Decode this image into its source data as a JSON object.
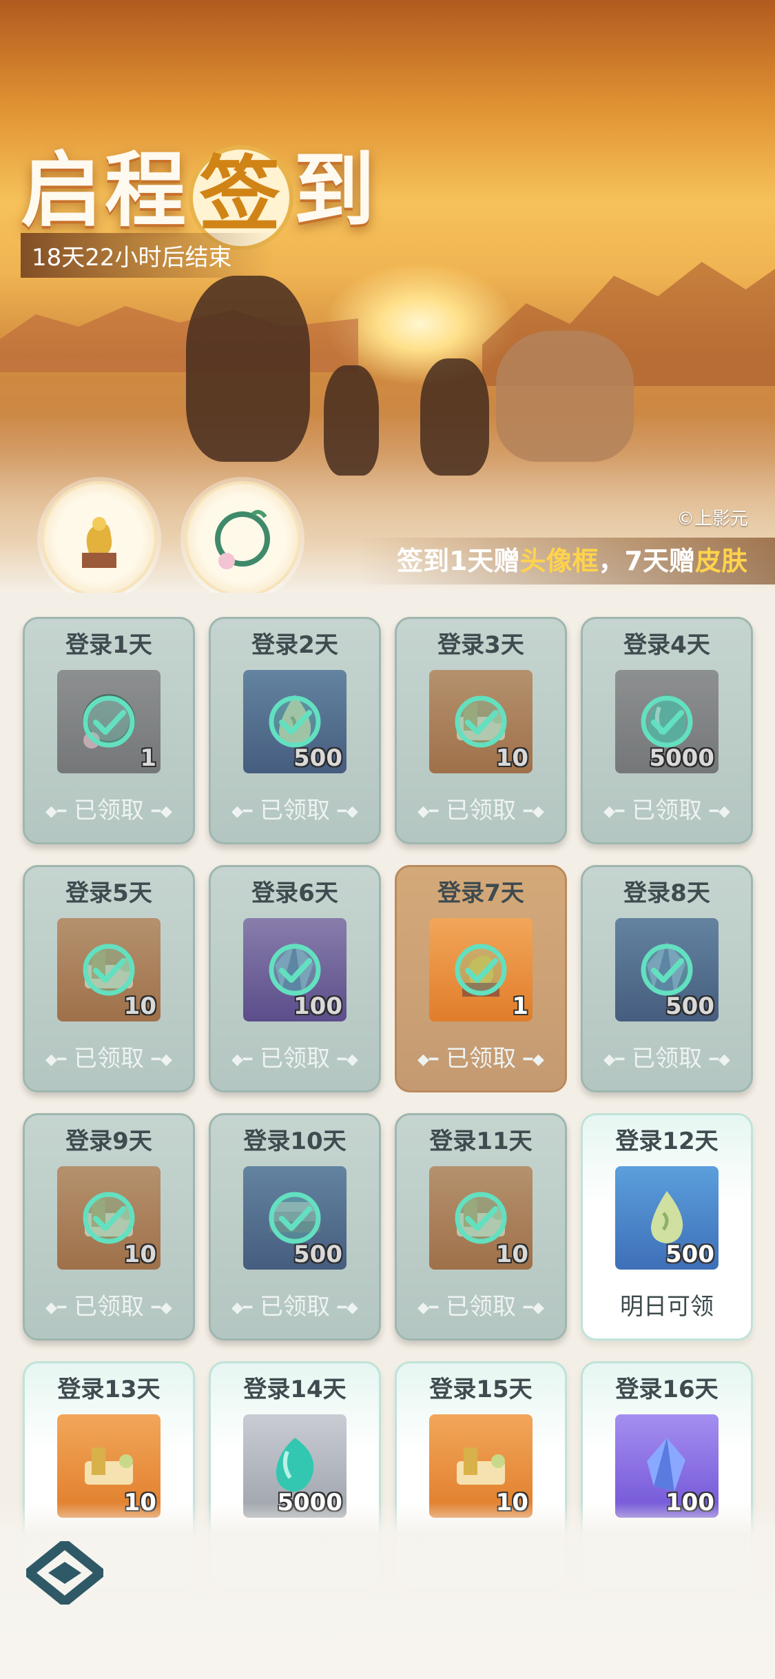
{
  "banner": {
    "title_part1": "启程",
    "title_badge": "签",
    "title_part2": "到",
    "countdown": "18天22小时后结束",
    "copyright": "©上影元",
    "promo": {
      "p1": "签到1天赠",
      "h1": "头像框",
      "p2": "，7天赠",
      "h2": "皮肤"
    },
    "rewards": [
      {
        "icon": "dragon-statue-icon"
      },
      {
        "icon": "avatar-frame-icon"
      }
    ]
  },
  "colors": {
    "claimed_card": "#b4c6c1",
    "special_card": "#c49a72",
    "open_card": "#ffffff",
    "check": "#63e0c0",
    "highlight": "#ffd34d"
  },
  "days": [
    {
      "label": "登录1天",
      "qty": "1",
      "item": "avatar-frame-icon",
      "bg": "grey",
      "status": "已领取",
      "state": "claimed"
    },
    {
      "label": "登录2天",
      "qty": "500",
      "item": "jade-drop-icon",
      "bg": "blue",
      "status": "已领取",
      "state": "claimed"
    },
    {
      "label": "登录3天",
      "qty": "10",
      "item": "scroll-icon",
      "bg": "orange",
      "status": "已领取",
      "state": "claimed"
    },
    {
      "label": "登录4天",
      "qty": "5000",
      "item": "teal-gem-icon",
      "bg": "grey",
      "status": "已领取",
      "state": "claimed"
    },
    {
      "label": "登录5天",
      "qty": "10",
      "item": "scroll-icon",
      "bg": "orange",
      "status": "已领取",
      "state": "claimed"
    },
    {
      "label": "登录6天",
      "qty": "100",
      "item": "crystal-icon",
      "bg": "purple",
      "status": "已领取",
      "state": "claimed"
    },
    {
      "label": "登录7天",
      "qty": "1",
      "item": "dragon-statue-icon",
      "bg": "orange",
      "status": "已领取",
      "state": "special"
    },
    {
      "label": "登录8天",
      "qty": "500",
      "item": "crystal-icon",
      "bg": "blue",
      "status": "已领取",
      "state": "claimed"
    },
    {
      "label": "登录9天",
      "qty": "10",
      "item": "scroll-icon",
      "bg": "orange",
      "status": "已领取",
      "state": "claimed"
    },
    {
      "label": "登录10天",
      "qty": "500",
      "item": "book-stack-icon",
      "bg": "blue",
      "status": "已领取",
      "state": "claimed"
    },
    {
      "label": "登录11天",
      "qty": "10",
      "item": "scroll-icon",
      "bg": "orange",
      "status": "已领取",
      "state": "claimed"
    },
    {
      "label": "登录12天",
      "qty": "500",
      "item": "jade-drop-icon",
      "bg": "blue",
      "status": "明日可领",
      "state": "open"
    },
    {
      "label": "登录13天",
      "qty": "10",
      "item": "scroll-icon",
      "bg": "orange",
      "status": "",
      "state": "open"
    },
    {
      "label": "登录14天",
      "qty": "5000",
      "item": "teal-gem-icon",
      "bg": "silver",
      "status": "",
      "state": "open"
    },
    {
      "label": "登录15天",
      "qty": "10",
      "item": "scroll-icon",
      "bg": "orange",
      "status": "",
      "state": "open"
    },
    {
      "label": "登录16天",
      "qty": "100",
      "item": "crystal-icon",
      "bg": "purple",
      "status": "",
      "state": "open"
    }
  ]
}
